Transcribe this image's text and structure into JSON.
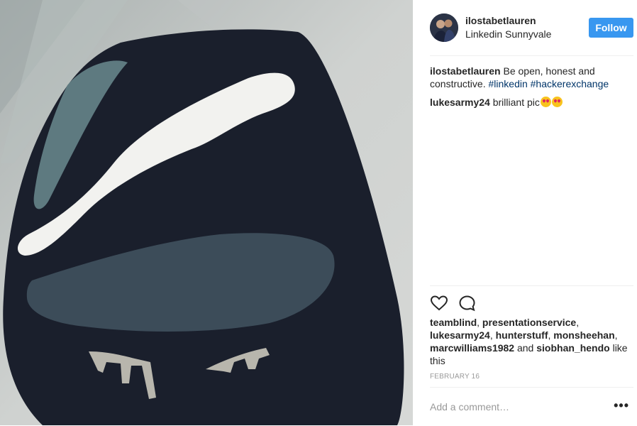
{
  "post": {
    "author": "ilostabetlauren",
    "location": "Linkedin Sunnyvale",
    "follow_label": "Follow",
    "caption": {
      "user": "ilostabetlauren",
      "text": "Be open, honest and constructive.",
      "hashtags": [
        "#linkedin",
        "#hackerexchange"
      ]
    },
    "comments": [
      {
        "user": "lukesarmy24",
        "text": "brilliant pic",
        "emoji": "heart-eyes-emoji ×2"
      }
    ],
    "likes": {
      "names": [
        "teamblind",
        "presentationservice",
        "lukesarmy24",
        "hunterstuff",
        "monsheehan",
        "marcwilliams1982"
      ],
      "and_word": "and",
      "last": "siobhan_hendo",
      "suffix": "like this"
    },
    "date": "FEBRUARY 16",
    "add_comment_placeholder": "Add a comment…",
    "more_label": "•••"
  },
  "icons": {
    "like": "heart-outline-icon",
    "comment": "speech-bubble-icon"
  },
  "colors": {
    "follow_button": "#3897f0",
    "hashtag": "#003569",
    "meta": "#999999"
  }
}
